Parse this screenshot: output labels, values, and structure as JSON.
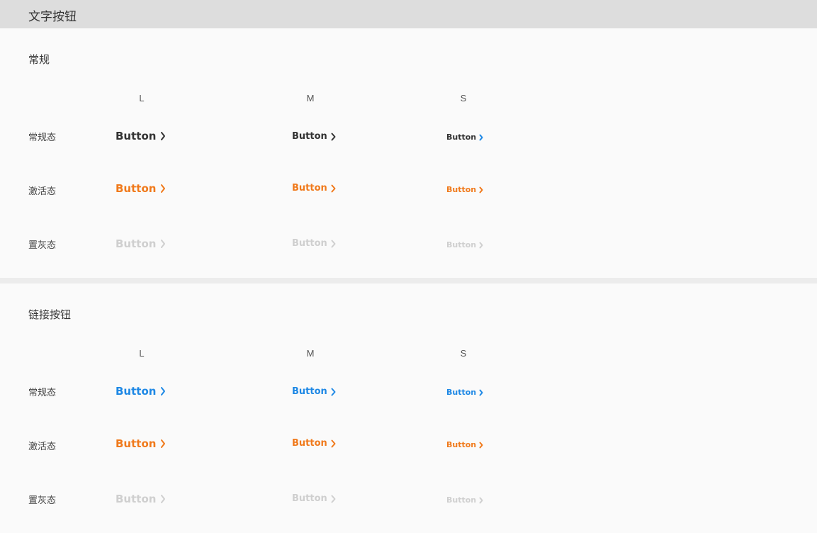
{
  "header": {
    "title": "文字按钮"
  },
  "sections": [
    {
      "title": "常规",
      "columns": [
        "L",
        "M",
        "S"
      ],
      "rows": [
        {
          "label": "常规态",
          "button_label": "Button"
        },
        {
          "label": "激活态",
          "button_label": "Button"
        },
        {
          "label": "置灰态",
          "button_label": "Button"
        }
      ]
    },
    {
      "title": "链接按钮",
      "columns": [
        "L",
        "M",
        "S"
      ],
      "rows": [
        {
          "label": "常规态",
          "button_label": "Button"
        },
        {
          "label": "激活态",
          "button_label": "Button"
        },
        {
          "label": "置灰态",
          "button_label": "Button"
        }
      ]
    }
  ],
  "icons": {
    "chevron": "chevron-right-icon"
  },
  "colors": {
    "normal": "#333333",
    "active": "#f07a1c",
    "disabled": "#cfcfcf",
    "link": "#1e88e5"
  }
}
